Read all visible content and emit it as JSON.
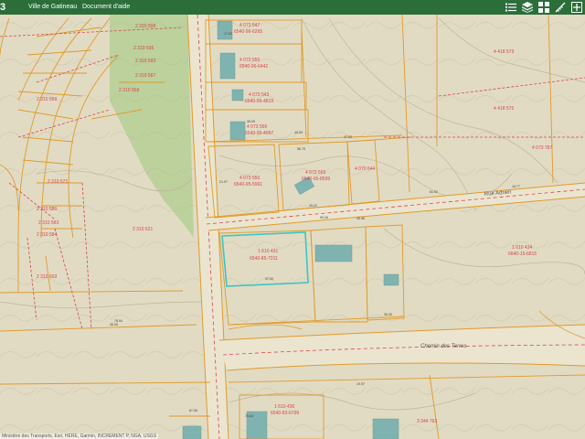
{
  "app": {
    "logo": "3",
    "links": [
      "Ville de Gatineau",
      "Document d'aide"
    ],
    "tools": [
      {
        "name": "legend-list-icon"
      },
      {
        "name": "layers-icon"
      },
      {
        "name": "basemap-grid-icon"
      },
      {
        "name": "measure-icon"
      },
      {
        "name": "expand-icon"
      }
    ]
  },
  "colors": {
    "header": "#2b6e3a",
    "lot_line": "#e09a2a",
    "boundary_red": "#d6454f",
    "selection": "#39c6c6",
    "park_green": "#9cc97c",
    "building": "#7fb3b0"
  },
  "map": {
    "roads": [
      "Rue Adrien",
      "Chemin des Terres"
    ],
    "lots": [
      {
        "number": "2 310 598",
        "code": ""
      },
      {
        "number": "2 310 595",
        "code": ""
      },
      {
        "number": "2 310 593",
        "code": ""
      },
      {
        "number": "2 310 567",
        "code": ""
      },
      {
        "number": "2 310 568",
        "code": ""
      },
      {
        "number": "2 310 569",
        "code": ""
      },
      {
        "number": "2 310 571",
        "code": ""
      },
      {
        "number": "2 310 580",
        "code": ""
      },
      {
        "number": "2 310 583",
        "code": ""
      },
      {
        "number": "2 310 584",
        "code": ""
      },
      {
        "number": "2 310 603",
        "code": ""
      },
      {
        "number": "2 310 621",
        "code": ""
      },
      {
        "number": "4 073 547",
        "code": "6540-96-6265"
      },
      {
        "number": "4 073 550",
        "code": "6540-96-6442"
      },
      {
        "number": "4 073 543",
        "code": "6540-96-4819"
      },
      {
        "number": "4 073 556",
        "code": "6540-95-4097"
      },
      {
        "number": "4 073 550",
        "code": "6540-95-5961"
      },
      {
        "number": "4 073 565",
        "code": "6540-95-8599"
      },
      {
        "number": "4 070 644",
        "code": ""
      },
      {
        "number": "4 418 579",
        "code": ""
      },
      {
        "number": "4 418 575",
        "code": ""
      },
      {
        "number": "4 073 787",
        "code": ""
      },
      {
        "number": "1 610 431",
        "code": "6540-85-7311"
      },
      {
        "number": "1 610 434",
        "code": "6640-15-6815"
      },
      {
        "number": "1 610 436",
        "code": "6540-83-6799"
      },
      {
        "number": "3 344 763",
        "code": ""
      }
    ],
    "dims": [
      "38.05",
      "78.94",
      "56.75",
      "47.32",
      "21.97",
      "49.22",
      "99.26",
      "45.36",
      "37.00",
      "36.05",
      "61.92",
      "16.77",
      "17.83",
      "35.09",
      "45.53",
      "75.64",
      "19.97",
      "67.56"
    ],
    "attribution": "Ministère des Transports, Esri, HERE, Garmin, INCREMENT P, NGA, USGS"
  }
}
